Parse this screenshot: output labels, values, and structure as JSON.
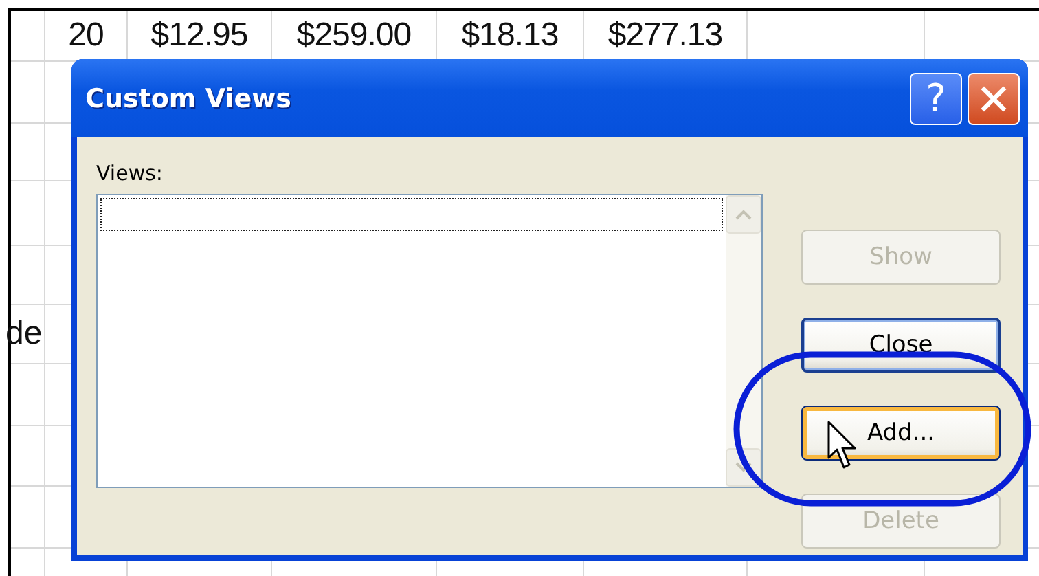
{
  "sheet": {
    "values": [
      "20",
      "$12.95",
      "$259.00",
      "$18.13",
      "$277.13"
    ],
    "side_text": "de"
  },
  "dialog": {
    "title": "Custom Views",
    "help_label": "?",
    "views_label": "Views:",
    "views_list": {
      "focused": true
    },
    "buttons": [
      {
        "label": "Show",
        "disabled": true,
        "default": false,
        "hovered": false
      },
      {
        "label": "Close",
        "disabled": false,
        "default": true,
        "hovered": false
      },
      {
        "label": "Add...",
        "disabled": false,
        "default": false,
        "hovered": true
      },
      {
        "label": "Delete",
        "disabled": true,
        "default": false,
        "hovered": false
      }
    ]
  }
}
